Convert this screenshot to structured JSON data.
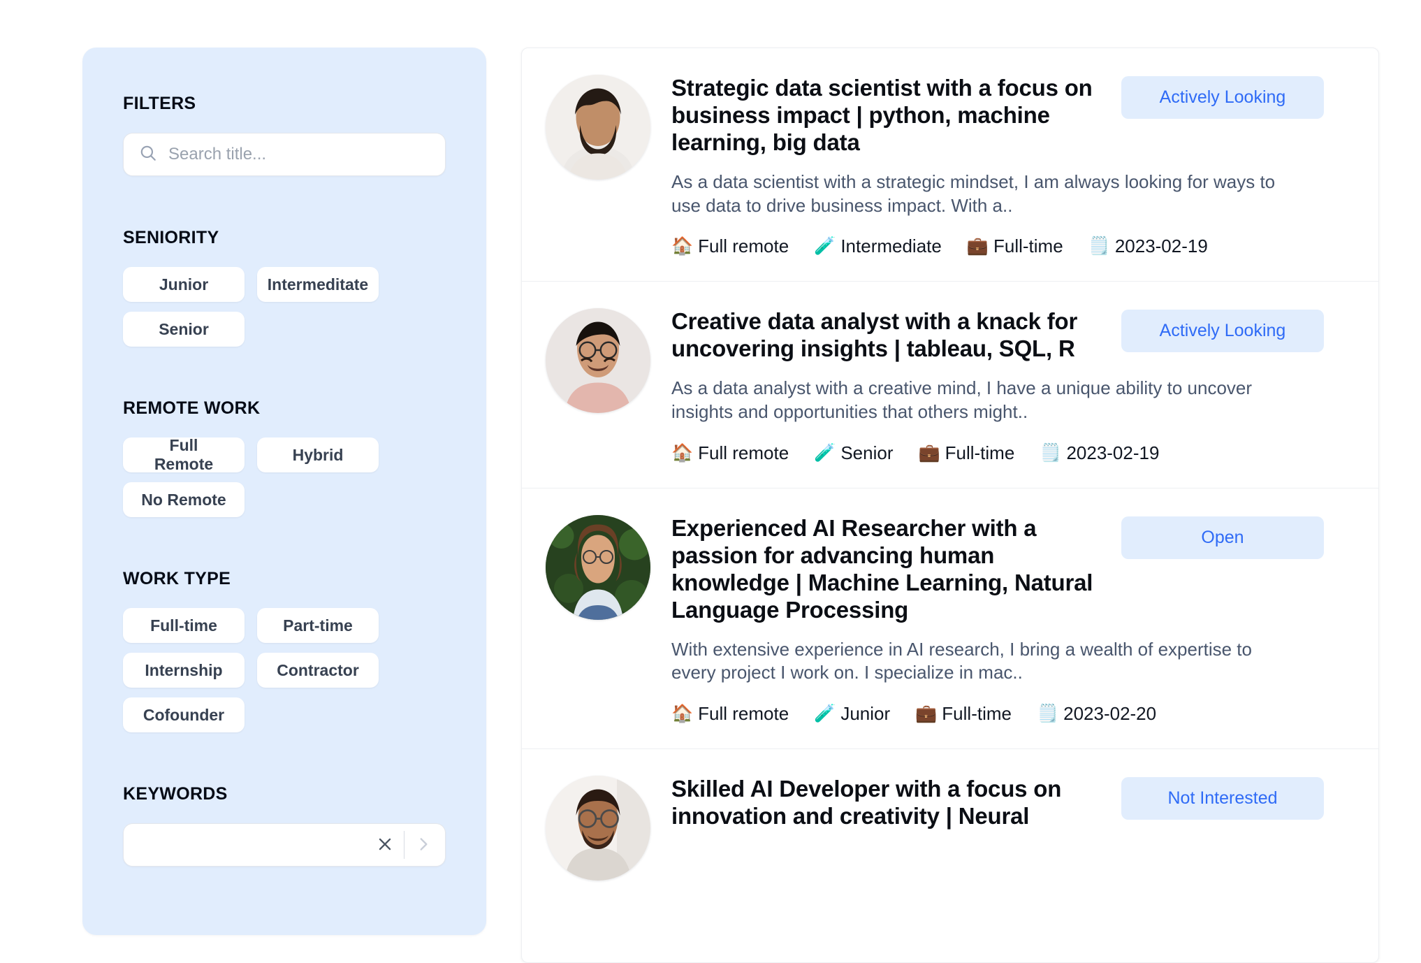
{
  "sidebar": {
    "filters_label": "FILTERS",
    "search": {
      "placeholder": "Search title...",
      "value": "",
      "icon": "search-icon"
    },
    "seniority": {
      "label": "SENIORITY",
      "options": [
        "Junior",
        "Intermeditate",
        "Senior"
      ]
    },
    "remote_work": {
      "label": "REMOTE WORK",
      "options": [
        "Full Remote",
        "Hybrid",
        "No Remote"
      ]
    },
    "work_type": {
      "label": "WORK TYPE",
      "options": [
        "Full-time",
        "Part-time",
        "Internship",
        "Contractor",
        "Cofounder"
      ]
    },
    "keywords": {
      "label": "KEYWORDS",
      "value": "",
      "placeholder": "",
      "clear_icon": "close-icon",
      "submit_icon": "chevron-right-icon"
    }
  },
  "results": {
    "cards": [
      {
        "avatar": "avatar-bearded-man",
        "title": "Strategic data scientist with a focus on business impact | python, machine learning, big data",
        "status": "Actively Looking",
        "description": "As a data scientist with a strategic mindset, I am always looking for ways to use data to drive business impact. With a..",
        "meta": [
          {
            "icon": "house-emoji",
            "emoji": "🏠",
            "text": "Full remote"
          },
          {
            "icon": "test-tube-emoji",
            "emoji": "🧪",
            "text": "Intermediate"
          },
          {
            "icon": "briefcase-emoji",
            "emoji": "💼",
            "text": "Full-time"
          },
          {
            "icon": "notepad-emoji",
            "emoji": "🗒️",
            "text": "2023-02-19"
          }
        ]
      },
      {
        "avatar": "avatar-glasses-man",
        "title": "Creative data analyst with a knack for uncovering insights | tableau, SQL, R",
        "status": "Actively Looking",
        "description": "As a data analyst with a creative mind, I have a unique ability to uncover insights and opportunities that others might..",
        "meta": [
          {
            "icon": "house-emoji",
            "emoji": "🏠",
            "text": "Full remote"
          },
          {
            "icon": "test-tube-emoji",
            "emoji": "🧪",
            "text": "Senior"
          },
          {
            "icon": "briefcase-emoji",
            "emoji": "💼",
            "text": "Full-time"
          },
          {
            "icon": "notepad-emoji",
            "emoji": "🗒️",
            "text": "2023-02-19"
          }
        ]
      },
      {
        "avatar": "avatar-woman-outdoors",
        "title": "Experienced AI Researcher with a passion for advancing human knowledge | Machine Learning, Natural Language Processing",
        "status": "Open",
        "description": "With extensive experience in AI research, I bring a wealth of expertise to every project I work on. I specialize in mac..",
        "meta": [
          {
            "icon": "house-emoji",
            "emoji": "🏠",
            "text": "Full remote"
          },
          {
            "icon": "test-tube-emoji",
            "emoji": "🧪",
            "text": "Junior"
          },
          {
            "icon": "briefcase-emoji",
            "emoji": "💼",
            "text": "Full-time"
          },
          {
            "icon": "notepad-emoji",
            "emoji": "🗒️",
            "text": "2023-02-20"
          }
        ]
      },
      {
        "avatar": "avatar-round-glasses-man",
        "title": "Skilled AI Developer with a focus on innovation and creativity | Neural",
        "status": "Not Interested",
        "description": "",
        "meta": []
      }
    ]
  },
  "colors": {
    "sidebar_bg": "#e1edfd",
    "badge_bg": "#e1edfd",
    "badge_text": "#2f6bf6",
    "chip_bg": "#ffffff",
    "page_bg": "#ffffff",
    "title_text": "#0b0e14",
    "desc_text": "#49566d"
  }
}
